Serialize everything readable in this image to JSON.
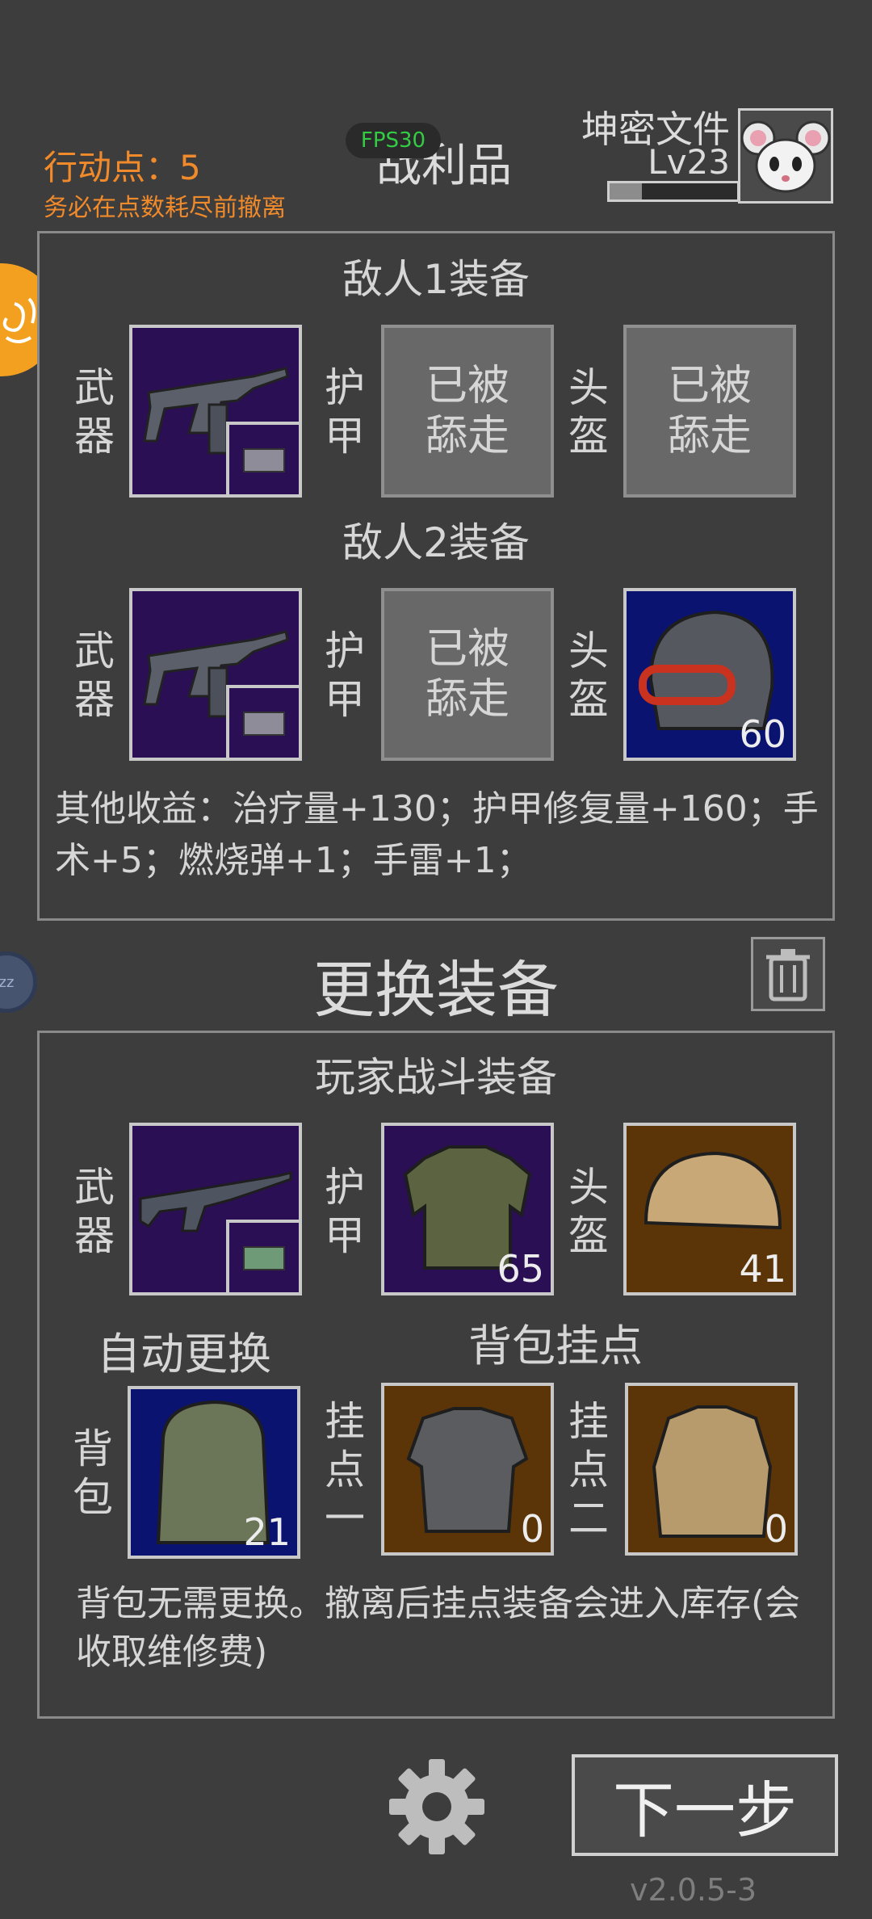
{
  "status": {
    "action_points": "行动点：5",
    "action_hint": "务必在点数耗尽前撤离",
    "fps": "FPS30",
    "screen_title": "战利品"
  },
  "player": {
    "name": "坤密文件",
    "level": "Lv23",
    "xp_progress": 0.25
  },
  "loot": {
    "enemy1": {
      "title": "敌人1装备",
      "weapon_label": "武器",
      "armor_label": "护甲",
      "helmet_label": "头盔",
      "armor_status": "已被舔走",
      "helmet_status": "已被舔走"
    },
    "enemy2": {
      "title": "敌人2装备",
      "weapon_label": "武器",
      "armor_label": "护甲",
      "helmet_label": "头盔",
      "armor_status": "已被舔走",
      "helmet_value": "60"
    },
    "other_income": "其他收益：治疗量+130；护甲修复量+160；手术+5；燃烧弹+1；手雷+1；"
  },
  "swap": {
    "title": "更换装备",
    "combat_title": "玩家战斗装备",
    "weapon_label": "武器",
    "armor_label": "护甲",
    "helmet_label": "头盔",
    "armor_value": "65",
    "helmet_value": "41",
    "auto_swap": "自动更换",
    "backpack_mounts_title": "背包挂点",
    "backpack_label": "背包",
    "backpack_value": "21",
    "mount1_label": "挂点一",
    "mount1_value": "0",
    "mount2_label": "挂点二",
    "mount2_value": "0",
    "note": "背包无需更换。撤离后挂点装备会进入库存(会收取维修费)"
  },
  "footer": {
    "next_button": "下一步",
    "version": "v2.0.5-3"
  },
  "colors": {
    "background": "#3d3d3d",
    "accent_orange": "#f08a2a",
    "fps_green": "#33cc44",
    "rarity_purple": "#2a0f55",
    "rarity_blue": "#0a1370",
    "rarity_brown": "#5b3508"
  }
}
